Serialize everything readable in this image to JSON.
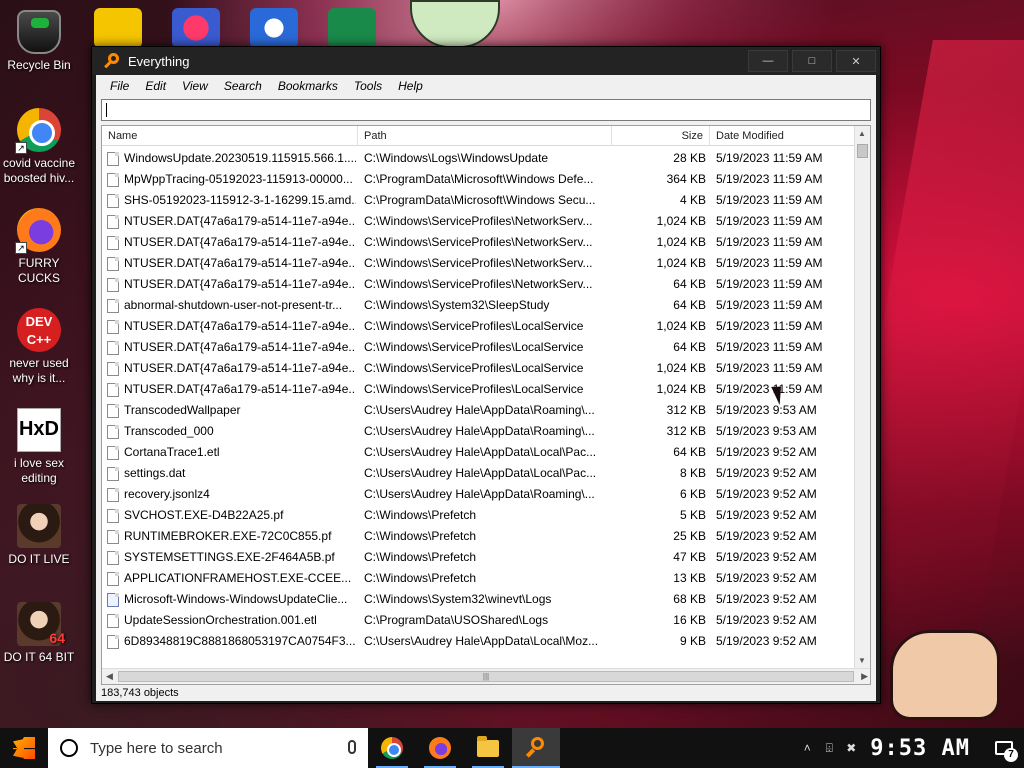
{
  "desktop": {
    "icons": [
      {
        "label": "Recycle Bin",
        "icon": "recycle-bin-icon"
      },
      {
        "label": "covid vaccine boosted hiv...",
        "icon": "chrome-icon"
      },
      {
        "label": "FURRY CUCKS",
        "icon": "firefox-icon"
      },
      {
        "label": "never used why is it...",
        "icon": "devcpp-icon",
        "glyph": "DEV C++"
      },
      {
        "label": "i love sex editing",
        "icon": "hxd-icon",
        "glyph": "HxD"
      },
      {
        "label": "DO IT LIVE",
        "icon": "portrait-icon"
      },
      {
        "label": "DO IT 64 BIT",
        "icon": "portrait-icon",
        "overlay": "64"
      }
    ]
  },
  "window": {
    "title": "Everything",
    "controls": {
      "minimize": "—",
      "maximize": "□",
      "close": "✕"
    },
    "menu": [
      "File",
      "Edit",
      "View",
      "Search",
      "Bookmarks",
      "Tools",
      "Help"
    ],
    "search_value": "",
    "columns": {
      "name": "Name",
      "path": "Path",
      "size": "Size",
      "date": "Date Modified"
    },
    "rows": [
      {
        "name": "WindowsUpdate.20230519.115915.566.1....",
        "path": "C:\\Windows\\Logs\\WindowsUpdate",
        "size": "28 KB",
        "date": "5/19/2023 11:59 AM"
      },
      {
        "name": "MpWppTracing-05192023-115913-00000...",
        "path": "C:\\ProgramData\\Microsoft\\Windows Defe...",
        "size": "364 KB",
        "date": "5/19/2023 11:59 AM"
      },
      {
        "name": "SHS-05192023-115912-3-1-16299.15.amd...",
        "path": "C:\\ProgramData\\Microsoft\\Windows Secu...",
        "size": "4 KB",
        "date": "5/19/2023 11:59 AM"
      },
      {
        "name": "NTUSER.DAT{47a6a179-a514-11e7-a94e...",
        "path": "C:\\Windows\\ServiceProfiles\\NetworkServ...",
        "size": "1,024 KB",
        "date": "5/19/2023 11:59 AM"
      },
      {
        "name": "NTUSER.DAT{47a6a179-a514-11e7-a94e...",
        "path": "C:\\Windows\\ServiceProfiles\\NetworkServ...",
        "size": "1,024 KB",
        "date": "5/19/2023 11:59 AM"
      },
      {
        "name": "NTUSER.DAT{47a6a179-a514-11e7-a94e...",
        "path": "C:\\Windows\\ServiceProfiles\\NetworkServ...",
        "size": "1,024 KB",
        "date": "5/19/2023 11:59 AM"
      },
      {
        "name": "NTUSER.DAT{47a6a179-a514-11e7-a94e...",
        "path": "C:\\Windows\\ServiceProfiles\\NetworkServ...",
        "size": "64 KB",
        "date": "5/19/2023 11:59 AM"
      },
      {
        "name": "abnormal-shutdown-user-not-present-tr...",
        "path": "C:\\Windows\\System32\\SleepStudy",
        "size": "64 KB",
        "date": "5/19/2023 11:59 AM"
      },
      {
        "name": "NTUSER.DAT{47a6a179-a514-11e7-a94e...",
        "path": "C:\\Windows\\ServiceProfiles\\LocalService",
        "size": "1,024 KB",
        "date": "5/19/2023 11:59 AM"
      },
      {
        "name": "NTUSER.DAT{47a6a179-a514-11e7-a94e...",
        "path": "C:\\Windows\\ServiceProfiles\\LocalService",
        "size": "64 KB",
        "date": "5/19/2023 11:59 AM"
      },
      {
        "name": "NTUSER.DAT{47a6a179-a514-11e7-a94e...",
        "path": "C:\\Windows\\ServiceProfiles\\LocalService",
        "size": "1,024 KB",
        "date": "5/19/2023 11:59 AM"
      },
      {
        "name": "NTUSER.DAT{47a6a179-a514-11e7-a94e...",
        "path": "C:\\Windows\\ServiceProfiles\\LocalService",
        "size": "1,024 KB",
        "date": "5/19/2023 11:59 AM"
      },
      {
        "name": "TranscodedWallpaper",
        "path": "C:\\Users\\Audrey Hale\\AppData\\Roaming\\...",
        "size": "312 KB",
        "date": "5/19/2023 9:53 AM"
      },
      {
        "name": "Transcoded_000",
        "path": "C:\\Users\\Audrey Hale\\AppData\\Roaming\\...",
        "size": "312 KB",
        "date": "5/19/2023 9:53 AM"
      },
      {
        "name": "CortanaTrace1.etl",
        "path": "C:\\Users\\Audrey Hale\\AppData\\Local\\Pac...",
        "size": "64 KB",
        "date": "5/19/2023 9:52 AM"
      },
      {
        "name": "settings.dat",
        "path": "C:\\Users\\Audrey Hale\\AppData\\Local\\Pac...",
        "size": "8 KB",
        "date": "5/19/2023 9:52 AM"
      },
      {
        "name": "recovery.jsonlz4",
        "path": "C:\\Users\\Audrey Hale\\AppData\\Roaming\\...",
        "size": "6 KB",
        "date": "5/19/2023 9:52 AM"
      },
      {
        "name": "SVCHOST.EXE-D4B22A25.pf",
        "path": "C:\\Windows\\Prefetch",
        "size": "5 KB",
        "date": "5/19/2023 9:52 AM"
      },
      {
        "name": "RUNTIMEBROKER.EXE-72C0C855.pf",
        "path": "C:\\Windows\\Prefetch",
        "size": "25 KB",
        "date": "5/19/2023 9:52 AM"
      },
      {
        "name": "SYSTEMSETTINGS.EXE-2F464A5B.pf",
        "path": "C:\\Windows\\Prefetch",
        "size": "47 KB",
        "date": "5/19/2023 9:52 AM"
      },
      {
        "name": "APPLICATIONFRAMEHOST.EXE-CCEE...",
        "path": "C:\\Windows\\Prefetch",
        "size": "13 KB",
        "date": "5/19/2023 9:52 AM"
      },
      {
        "name": "Microsoft-Windows-WindowsUpdateClie...",
        "path": "C:\\Windows\\System32\\winevt\\Logs",
        "size": "68 KB",
        "date": "5/19/2023 9:52 AM",
        "icon": "event-log-icon"
      },
      {
        "name": "UpdateSessionOrchestration.001.etl",
        "path": "C:\\ProgramData\\USOShared\\Logs",
        "size": "16 KB",
        "date": "5/19/2023 9:52 AM"
      },
      {
        "name": "6D89348819C8881868053197CA0754F3...",
        "path": "C:\\Users\\Audrey Hale\\AppData\\Local\\Moz...",
        "size": "9 KB",
        "date": "5/19/2023 9:52 AM"
      }
    ],
    "status": "183,743 objects"
  },
  "taskbar": {
    "search_placeholder": "Type here to search",
    "apps": [
      {
        "name": "chrome-icon",
        "active": false
      },
      {
        "name": "firefox-icon",
        "active": false
      },
      {
        "name": "file-explorer-icon",
        "active": false
      },
      {
        "name": "everything-icon",
        "active": true
      }
    ],
    "tray": {
      "chevron": "˄",
      "network": "⌹",
      "volume": "✖"
    },
    "clock": "9:53 AM",
    "notifications": "7"
  }
}
